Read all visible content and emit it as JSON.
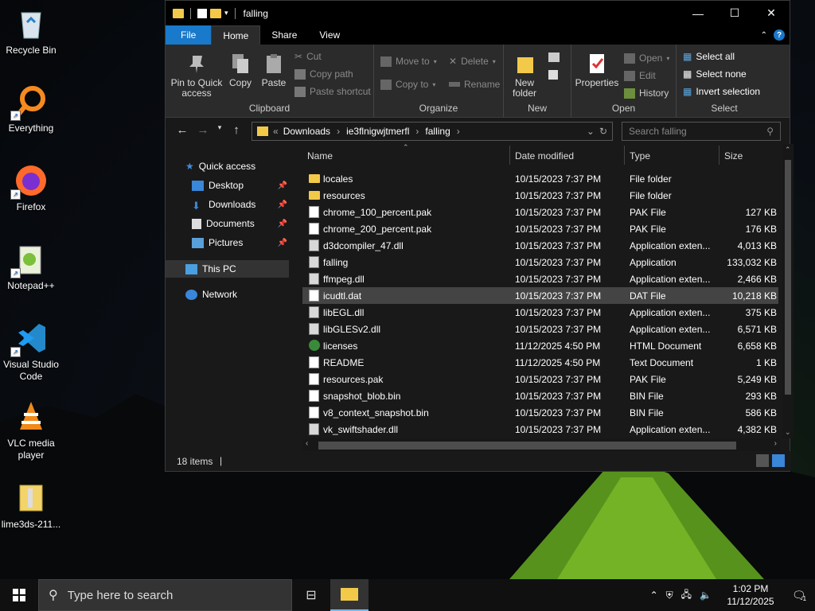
{
  "desktop": {
    "icons": [
      {
        "label": "Recycle Bin"
      },
      {
        "label": "Everything"
      },
      {
        "label": "Firefox"
      },
      {
        "label": "Notepad++"
      },
      {
        "label": "Visual Studio Code"
      },
      {
        "label": "VLC media player"
      },
      {
        "label": "lime3ds-211..."
      }
    ]
  },
  "window": {
    "title": "falling",
    "controls": {
      "minimize": "—",
      "maximize": "☐",
      "close": "✕"
    }
  },
  "tabs": {
    "file": "File",
    "home": "Home",
    "share": "Share",
    "view": "View"
  },
  "ribbon": {
    "clipboard": {
      "label": "Clipboard",
      "pin": "Pin to Quick access",
      "copy": "Copy",
      "paste": "Paste",
      "cut": "Cut",
      "copy_path": "Copy path",
      "paste_shortcut": "Paste shortcut"
    },
    "organize": {
      "label": "Organize",
      "move_to": "Move to",
      "copy_to": "Copy to",
      "delete": "Delete",
      "rename": "Rename"
    },
    "new": {
      "label": "New",
      "new_folder": "New folder"
    },
    "open": {
      "label": "Open",
      "properties": "Properties",
      "open": "Open",
      "edit": "Edit",
      "history": "History"
    },
    "select": {
      "label": "Select",
      "select_all": "Select all",
      "select_none": "Select none",
      "invert": "Invert selection"
    }
  },
  "address": {
    "breadcrumb": [
      "Downloads",
      "ie3flnigwjtmerfl",
      "falling"
    ],
    "search_placeholder": "Search falling"
  },
  "navpane": {
    "quick_access": "Quick access",
    "items": [
      {
        "label": "Desktop"
      },
      {
        "label": "Downloads"
      },
      {
        "label": "Documents"
      },
      {
        "label": "Pictures"
      }
    ],
    "this_pc": "This PC",
    "network": "Network"
  },
  "columns": {
    "name": "Name",
    "date": "Date modified",
    "type": "Type",
    "size": "Size"
  },
  "files": [
    {
      "name": "locales",
      "date": "10/15/2023 7:37 PM",
      "type": "File folder",
      "size": "",
      "icon": "folder-icon"
    },
    {
      "name": "resources",
      "date": "10/15/2023 7:37 PM",
      "type": "File folder",
      "size": "",
      "icon": "folder-icon"
    },
    {
      "name": "chrome_100_percent.pak",
      "date": "10/15/2023 7:37 PM",
      "type": "PAK File",
      "size": "127 KB",
      "icon": "file-icon"
    },
    {
      "name": "chrome_200_percent.pak",
      "date": "10/15/2023 7:37 PM",
      "type": "PAK File",
      "size": "176 KB",
      "icon": "file-icon"
    },
    {
      "name": "d3dcompiler_47.dll",
      "date": "10/15/2023 7:37 PM",
      "type": "Application exten...",
      "size": "4,013 KB",
      "icon": "dll-icon"
    },
    {
      "name": "falling",
      "date": "10/15/2023 7:37 PM",
      "type": "Application",
      "size": "133,032 KB",
      "icon": "app-icon"
    },
    {
      "name": "ffmpeg.dll",
      "date": "10/15/2023 7:37 PM",
      "type": "Application exten...",
      "size": "2,466 KB",
      "icon": "dll-icon"
    },
    {
      "name": "icudtl.dat",
      "date": "10/15/2023 7:37 PM",
      "type": "DAT File",
      "size": "10,218 KB",
      "icon": "file-icon"
    },
    {
      "name": "libEGL.dll",
      "date": "10/15/2023 7:37 PM",
      "type": "Application exten...",
      "size": "375 KB",
      "icon": "dll-icon"
    },
    {
      "name": "libGLESv2.dll",
      "date": "10/15/2023 7:37 PM",
      "type": "Application exten...",
      "size": "6,571 KB",
      "icon": "dll-icon"
    },
    {
      "name": "licenses",
      "date": "11/12/2025 4:50 PM",
      "type": "HTML Document",
      "size": "6,658 KB",
      "icon": "html-icon"
    },
    {
      "name": "README",
      "date": "11/12/2025 4:50 PM",
      "type": "Text Document",
      "size": "1 KB",
      "icon": "text-icon"
    },
    {
      "name": "resources.pak",
      "date": "10/15/2023 7:37 PM",
      "type": "PAK File",
      "size": "5,249 KB",
      "icon": "file-icon"
    },
    {
      "name": "snapshot_blob.bin",
      "date": "10/15/2023 7:37 PM",
      "type": "BIN File",
      "size": "293 KB",
      "icon": "file-icon"
    },
    {
      "name": "v8_context_snapshot.bin",
      "date": "10/15/2023 7:37 PM",
      "type": "BIN File",
      "size": "586 KB",
      "icon": "file-icon"
    },
    {
      "name": "vk_swiftshader.dll",
      "date": "10/15/2023 7:37 PM",
      "type": "Application exten...",
      "size": "4,382 KB",
      "icon": "dll-icon"
    }
  ],
  "selected_file": "icudtl.dat",
  "status": {
    "count": "18 items"
  },
  "taskbar": {
    "search_placeholder": "Type here to search",
    "time": "1:02 PM",
    "date": "11/12/2025",
    "notification_count": "1"
  },
  "colors": {
    "accent": "#1979ca",
    "folder": "#f3c94a",
    "selection": "#444444",
    "window_bg": "#191919"
  }
}
